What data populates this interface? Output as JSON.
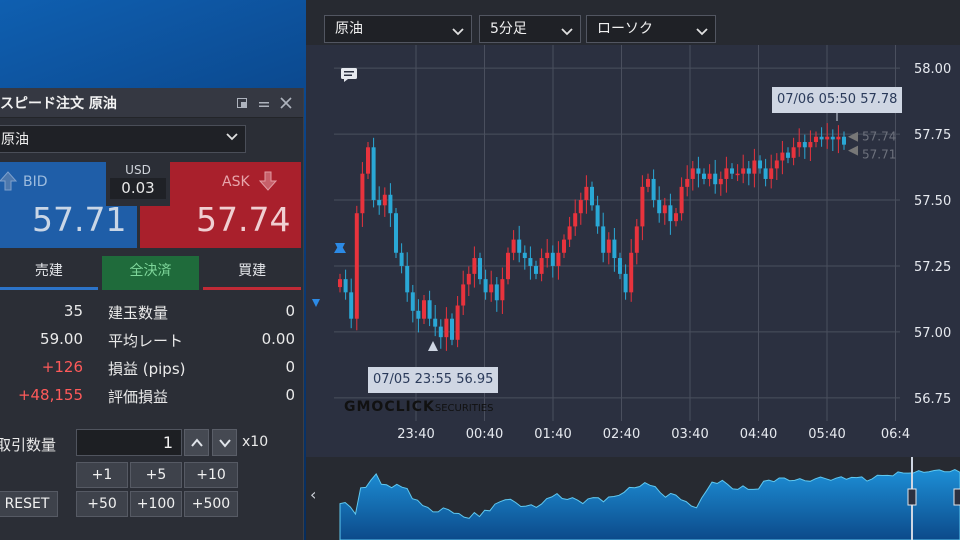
{
  "order_panel": {
    "title": "スピード注文 原油",
    "symbol": "原油",
    "bid_label": "BID",
    "ask_label": "ASK",
    "bid_price": "57.71",
    "ask_price": "57.74",
    "spread_currency": "USD",
    "spread_value": "0.03",
    "tabs": {
      "sell": "売建",
      "all": "全決済",
      "buy": "買建"
    },
    "rows": [
      {
        "left": "35",
        "label": "建玉数量",
        "right": "0",
        "left_red": false
      },
      {
        "left": "59.00",
        "label": "平均レート",
        "right": "0.00",
        "left_red": false
      },
      {
        "left": "+126",
        "label": "損益 (pips)",
        "right": "0",
        "left_red": true
      },
      {
        "left": "+48,155",
        "label": "評価損益",
        "right": "0",
        "left_red": true
      }
    ],
    "qty_label": "取引数量",
    "qty_value": "1",
    "qty_mult": "x10",
    "quick_buttons_row1": [
      "+1",
      "+5",
      "+10"
    ],
    "quick_buttons_row2": [
      "+50",
      "+100",
      "+500"
    ],
    "reset_label": "RESET"
  },
  "chart_window": {
    "dropdowns": {
      "symbol": "原油",
      "timeframe": "5分足",
      "chart_type": "ローソク"
    },
    "high_tooltip": "07/06 05:50 57.78",
    "low_tooltip": "07/05 23:55 56.95",
    "price_tags": {
      "ask": "57.74",
      "bid": "57.71"
    },
    "watermark_main": "GMOCLICK",
    "watermark_sub": "SECURITIES",
    "colors": {
      "up": "#e8333d",
      "down": "#2aa8d6",
      "background": "#2b3040",
      "grid": "#4a4f5e"
    }
  },
  "chart_data": {
    "type": "candlestick",
    "y_ticks": [
      "58.00",
      "57.75",
      "57.50",
      "57.25",
      "57.00",
      "56.75"
    ],
    "x_ticks": [
      "23:40",
      "00:40",
      "01:40",
      "02:40",
      "03:40",
      "04:40",
      "05:40",
      "06:4"
    ],
    "ylim": [
      56.7,
      58.05
    ],
    "close": [
      57.2,
      57.15,
      57.05,
      57.45,
      57.6,
      57.7,
      57.5,
      57.48,
      57.52,
      57.45,
      57.3,
      57.25,
      57.15,
      57.08,
      57.05,
      57.12,
      57.05,
      57.02,
      56.98,
      57.05,
      56.97,
      57.1,
      57.18,
      57.22,
      57.28,
      57.2,
      57.15,
      57.18,
      57.12,
      57.2,
      57.3,
      57.35,
      57.3,
      57.28,
      57.25,
      57.22,
      57.28,
      57.3,
      57.25,
      57.3,
      57.35,
      57.4,
      57.45,
      57.5,
      57.55,
      57.48,
      57.4,
      57.3,
      57.35,
      57.28,
      57.22,
      57.15,
      57.3,
      57.4,
      57.55,
      57.58,
      57.5,
      57.45,
      57.48,
      57.42,
      57.45,
      57.55,
      57.58,
      57.62,
      57.6,
      57.58,
      57.6,
      57.56,
      57.58,
      57.62,
      57.6,
      57.6,
      57.62,
      57.6,
      57.65,
      57.62,
      57.58,
      57.62,
      57.65,
      57.68,
      57.66,
      57.7,
      57.72,
      57.7,
      57.72,
      57.74,
      57.73,
      57.74,
      57.73,
      57.74,
      57.71
    ],
    "low_price": 56.95,
    "high_price": 57.78
  }
}
